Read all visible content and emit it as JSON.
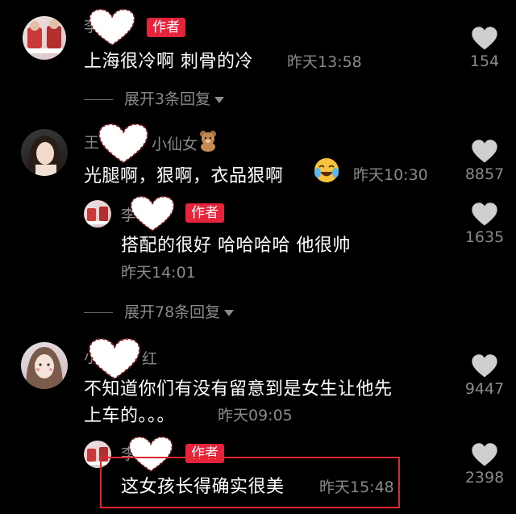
{
  "author_badge": "作者",
  "comments": [
    {
      "name_fragment": "李",
      "text": "上海很冷啊 刺骨的冷",
      "time": "昨天13:58",
      "likes": "154",
      "expand": "展开3条回复"
    },
    {
      "name_fragment_left": "王",
      "name_fragment_right": "小仙女",
      "text": "光腿啊，狠啊，衣品狠啊",
      "time": "昨天10:30",
      "likes": "8857",
      "reply": {
        "name_fragment": "李",
        "text": "搭配的很好 哈哈哈哈 他很帅",
        "time": "昨天14:01",
        "likes": "1635"
      },
      "expand": "展开78条回复"
    },
    {
      "name_fragment_left": "小",
      "name_fragment_right": "红",
      "text_line1": "不知道你们有没有留意到是女生让他先",
      "text_line2": "上车的。。。",
      "time": "昨天09:05",
      "likes": "9447",
      "reply": {
        "name_fragment": "李",
        "text": "这女孩长得确实很美",
        "time": "昨天15:48",
        "likes": "2398"
      }
    }
  ],
  "colors": {
    "badge": "#e5243b",
    "highlight_box": "#e0262d",
    "muted": "#8a8a8a"
  }
}
